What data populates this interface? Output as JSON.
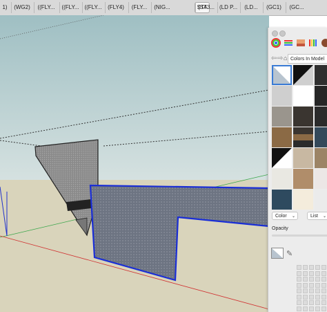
{
  "tabs": [
    {
      "label": "1)",
      "active": false
    },
    {
      "label": "(WG2)",
      "active": false
    },
    {
      "label": "((FLY...",
      "active": false
    },
    {
      "label": "((FLY...",
      "active": false
    },
    {
      "label": "((FLY...",
      "active": false
    },
    {
      "label": "(FLY4)",
      "active": false
    },
    {
      "label": "(FLY...",
      "active": false
    },
    {
      "label": "(NIG...",
      "active": false
    },
    {
      "label": "STA",
      "active": true
    },
    {
      "label": "(ST3...",
      "active": false
    },
    {
      "label": "(LD P...",
      "active": false
    },
    {
      "label": "(LD...",
      "active": false
    },
    {
      "label": "(GC1)",
      "active": false
    },
    {
      "label": "(GC...",
      "active": false
    }
  ],
  "materials_panel": {
    "library_name": "Colors In Model",
    "toolbar_icons": [
      "color-wheel-icon",
      "color-sliders-icon",
      "image-icon",
      "crayons-icon",
      "materials-icon"
    ],
    "nav_icons": [
      "back-arrow-icon",
      "forward-arrow-icon",
      "home-icon"
    ],
    "color_mode_select": "Color",
    "view_mode_select": "List",
    "opacity_label": "Opacity",
    "swatches": [
      {
        "name": "default-front-back",
        "color": "#ffffff",
        "selected": true
      },
      {
        "name": "black-white",
        "color": "#111111"
      },
      {
        "name": "dark-gray",
        "color": "#2f2f2f"
      },
      {
        "name": "light-gray",
        "color": "#cfcfcf"
      },
      {
        "name": "white",
        "color": "#ffffff"
      },
      {
        "name": "charcoal",
        "color": "#262626"
      },
      {
        "name": "stone",
        "color": "#9a958d"
      },
      {
        "name": "dark-wood",
        "color": "#3a3530"
      },
      {
        "name": "dark-stone",
        "color": "#2b2b2b"
      },
      {
        "name": "oak-wood",
        "color": "#8b6a45"
      },
      {
        "name": "mixed-brown",
        "color": "#5e5140"
      },
      {
        "name": "blue-granite",
        "color": "#34495a"
      },
      {
        "name": "black-white-split",
        "color": "#ffffff"
      },
      {
        "name": "beige-marble",
        "color": "#c8b8a2"
      },
      {
        "name": "tan-tile",
        "color": "#9c8466"
      },
      {
        "name": "off-white",
        "color": "#e9e8e2"
      },
      {
        "name": "light-wood",
        "color": "#b08d6a"
      },
      {
        "name": "white-marble",
        "color": "#ece7e6"
      },
      {
        "name": "navy-blue",
        "color": "#2e4a5f"
      },
      {
        "name": "cream",
        "color": "#f4ecdc"
      },
      {
        "name": "pale-gray",
        "color": "#ebebeb"
      }
    ]
  },
  "scene": {
    "sky_color_top": "#9fbfc3",
    "sky_color_bottom": "#d5e1e0",
    "ground_color": "#d9d4bb",
    "front_face_color": "#6b7280",
    "selection_color": "#1a2ed6"
  }
}
